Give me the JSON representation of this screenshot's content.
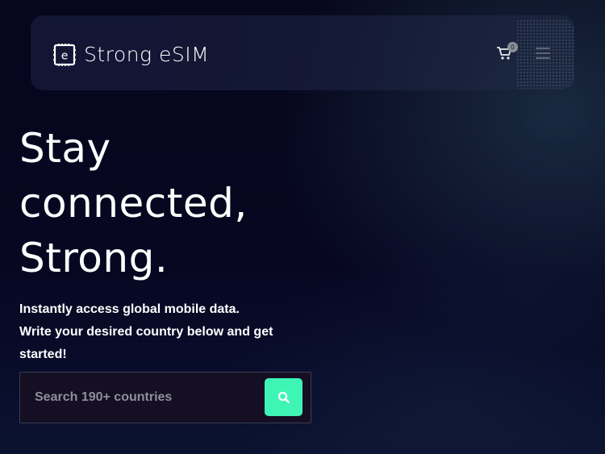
{
  "header": {
    "brand": "Strong eSIM",
    "logo_icon": "esim-chip-icon",
    "cart_icon": "cart-icon",
    "cart_count": "0",
    "menu_icon": "hamburger-menu-icon"
  },
  "hero": {
    "title_lines": [
      "Stay",
      "connected,",
      "Strong."
    ],
    "subtitle_line1": "Instantly access global mobile data.",
    "subtitle_line2": "Write your desired country below and get started!"
  },
  "search": {
    "placeholder": "Search 190+ countries",
    "value": "",
    "button_icon": "search-icon"
  },
  "colors": {
    "background": "#050519",
    "accent": "#3ef5b5",
    "text": "#ffffff"
  }
}
